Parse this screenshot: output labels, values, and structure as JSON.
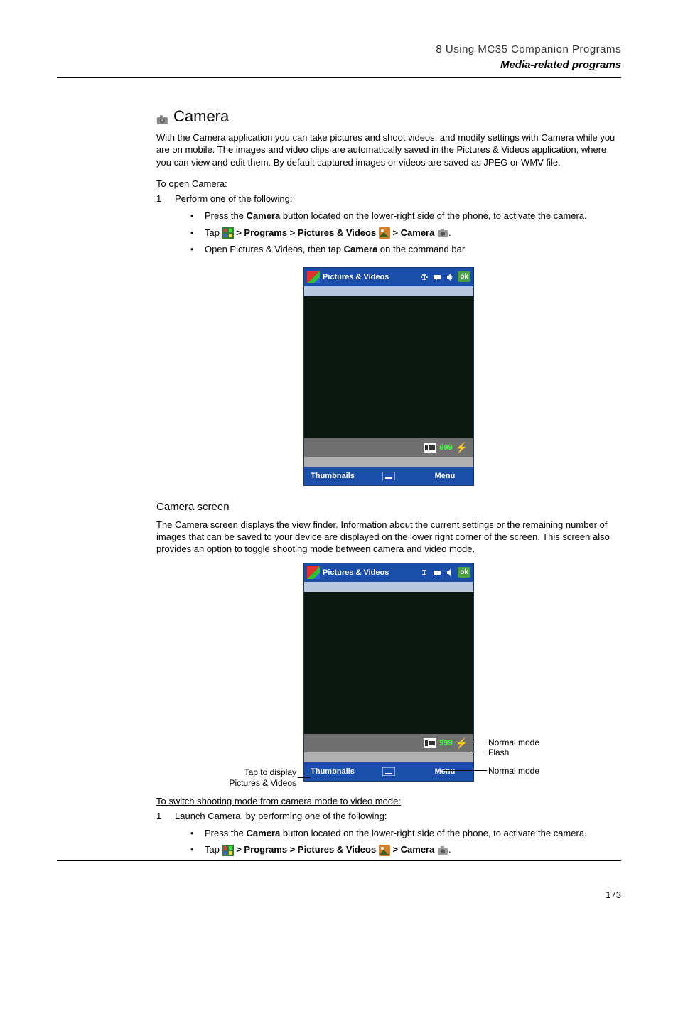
{
  "header": {
    "chapter": "8 Using MC35 Companion Programs",
    "section": "Media-related programs"
  },
  "camera_heading": "Camera",
  "intro_text": "With the Camera application you can take pictures and shoot videos, and modify settings with Camera while you are on mobile. The images and video clips are automatically saved in the Pictures & Videos application, where you can view and edit them. By default captured images or videos are saved as JPEG or WMV file.",
  "open_camera_label": "To open Camera:",
  "step_open": "Perform one of the following:",
  "bullet_open_1_a": "Press the ",
  "bullet_open_1_b": "Camera",
  "bullet_open_1_c": " button located on the lower-right side of the phone, to activate the camera.",
  "bullet_open_2_a": "Tap ",
  "bullet_open_2_b": " > Programs > Pictures & Videos ",
  "bullet_open_2_c": " > Camera ",
  "bullet_open_3_a": "Open Pictures & Videos, then tap ",
  "bullet_open_3_b": "Camera",
  "bullet_open_3_c": " on the command bar.",
  "screenshot1": {
    "title": "Pictures & Videos",
    "ok": "ok",
    "count": "999",
    "thumbnails": "Thumbnails",
    "menu": "Menu"
  },
  "camera_screen_heading": "Camera screen",
  "camera_screen_para": "The Camera screen displays the view finder. Information about the current settings or the remaining number of images that can be saved to your device are displayed on the lower right corner of the screen. This screen also provides an option to toggle shooting mode between camera and video mode.",
  "annotations": {
    "tap_display_a": "Tap to display",
    "tap_display_b": "Pictures & Videos",
    "normal_mode": "Normal mode",
    "flash": "Flash",
    "normal_mode2": "Normal mode"
  },
  "screenshot2": {
    "title": "Pictures & Videos",
    "ok": "ok",
    "count": "999",
    "thumbnails": "Thumbnails",
    "menu": "Menu"
  },
  "switch_label": "To switch shooting mode from camera mode to video mode:",
  "step_switch": "Launch Camera, by performing one of the following:",
  "bullet_switch_1_a": "Press the ",
  "bullet_switch_1_b": "Camera",
  "bullet_switch_1_c": " button located on the lower-right side of the phone, to activate the camera.",
  "bullet_switch_2_a": "Tap ",
  "bullet_switch_2_b": " > Programs > Pictures & Videos ",
  "bullet_switch_2_c": " > Camera ",
  "page_number": "173"
}
